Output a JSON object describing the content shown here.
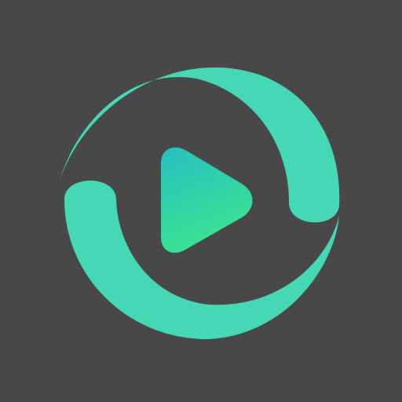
{
  "app_icon": {
    "icon_name": "video-player-app-icon",
    "glyphs": [
      "circular-swoosh-icon",
      "play-icon"
    ],
    "colors": {
      "background": "#484848",
      "swoosh": "#46D7B4",
      "play_gradient_top": "#27BFC1",
      "play_gradient_bottom": "#3CE391"
    }
  }
}
